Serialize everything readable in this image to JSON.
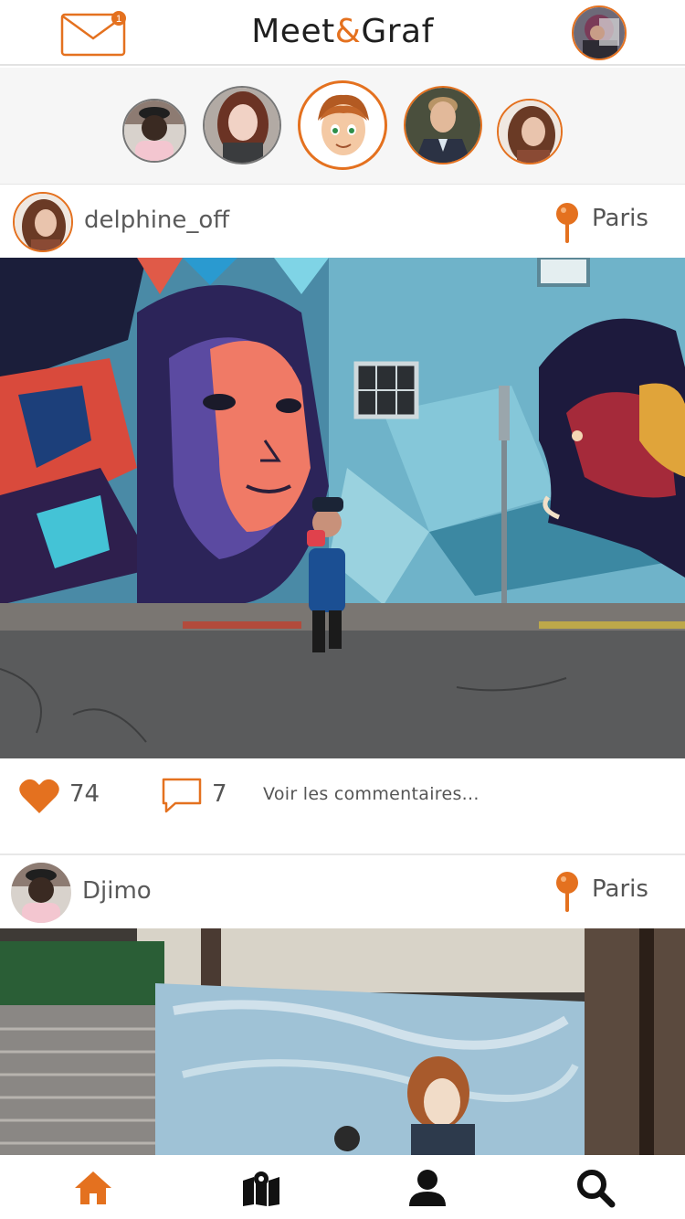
{
  "app": {
    "title_part1": "Meet",
    "title_amp": "&",
    "title_part2": "Graf",
    "mail_badge": "1"
  },
  "colors": {
    "accent": "#e4711f",
    "text": "#555555",
    "dark": "#1f1f1f"
  },
  "stories": [
    {
      "name": "story-djimo",
      "style": "grey"
    },
    {
      "name": "story-redhead",
      "style": "grey"
    },
    {
      "name": "story-cartoon-avatar",
      "style": "active"
    },
    {
      "name": "story-suit-man",
      "style": "orange"
    },
    {
      "name": "story-delphine",
      "style": "orange"
    }
  ],
  "posts": [
    {
      "username": "delphine_off",
      "location": "Paris",
      "likes": "74",
      "comments": "7",
      "see_comments": "Voir les commentaires..."
    },
    {
      "username": "Djimo",
      "location": "Paris"
    }
  ],
  "nav": {
    "items": [
      "home-icon",
      "map-icon",
      "profile-icon",
      "search-icon"
    ],
    "active": "home-icon"
  }
}
